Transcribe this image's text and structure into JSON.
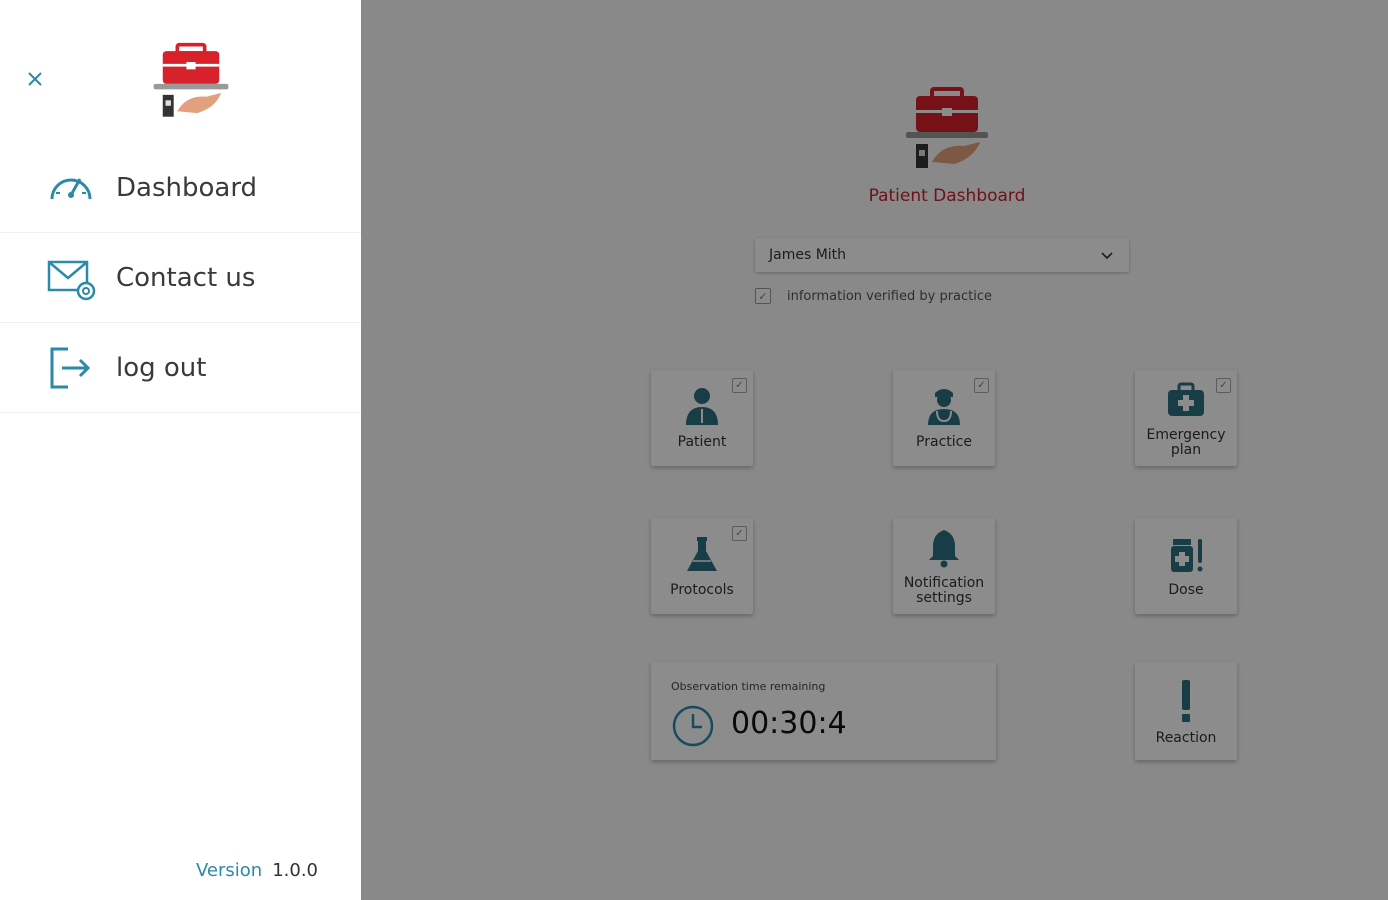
{
  "colors": {
    "accent": "#2a8aa8",
    "brand_red": "#c9222b",
    "icon_teal": "#2f6f82"
  },
  "drawer": {
    "close_icon": "close-icon",
    "menu": [
      {
        "label": "Dashboard",
        "icon": "speedometer-icon"
      },
      {
        "label": "Contact us",
        "icon": "mail-settings-icon"
      },
      {
        "label": "log out",
        "icon": "logout-icon"
      }
    ],
    "version_label": "Version",
    "version_number": "1.0.0"
  },
  "main": {
    "title": "Patient Dashboard",
    "patient_select": {
      "value": "James  Mith",
      "icon": "chevron-down-icon"
    },
    "verified_label": "information verified by practice",
    "tiles": [
      {
        "label": "Patient",
        "icon": "patient-icon",
        "checked": true
      },
      {
        "label": "Practice",
        "icon": "doctor-icon",
        "checked": true
      },
      {
        "label": "Emergency plan",
        "icon": "medkit-icon",
        "checked": true
      },
      {
        "label": "Protocols",
        "icon": "flask-icon",
        "checked": true
      },
      {
        "label": "Notification settings",
        "icon": "bell-icon",
        "checked": false
      },
      {
        "label": "Dose",
        "icon": "medicine-icon",
        "checked": false
      },
      {
        "label": "Reaction",
        "icon": "exclamation-icon",
        "checked": false
      }
    ],
    "observation": {
      "label": "Observation time remaining",
      "time": "00:30:4",
      "icon": "clock-icon"
    }
  }
}
